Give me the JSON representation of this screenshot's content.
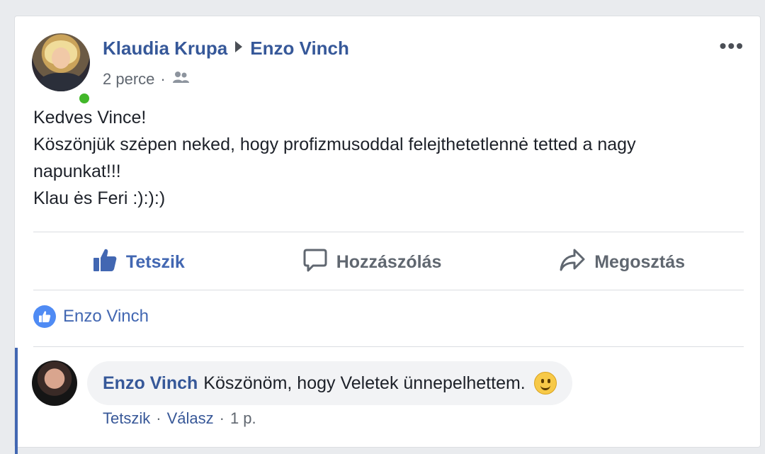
{
  "post": {
    "author": "Klaudia Krupa",
    "target": "Enzo Vinch",
    "time": "2 perce",
    "separator": "·",
    "more_label": "•••",
    "text_lines": [
      "Kedves Vince!",
      "Köszönjük szėpen neked, hogy profizmusoddal felejthetetlennė tetted a nagy",
      "napunkat!!!",
      "Klau ės Feri :):):)"
    ]
  },
  "actions": {
    "like": "Tetszik",
    "comment": "Hozzászólás",
    "share": "Megosztás"
  },
  "likes": {
    "names": "Enzo Vinch"
  },
  "comment": {
    "author": "Enzo Vinch",
    "text": "Köszönöm, hogy Veletek ünnepelhettem.",
    "like_link": "Tetszik",
    "reply_link": "Válasz",
    "time": "1 p.",
    "separator": "·"
  },
  "colors": {
    "link": "#365899",
    "like_blue": "#4267b2",
    "online": "#42b72a",
    "bubble_bg": "#f2f3f5"
  },
  "icons": {
    "audience": "friends-icon",
    "like": "thumbs-up-icon",
    "comment": "speech-bubble-icon",
    "share": "share-arrow-icon",
    "emoji": "smiley-emoji"
  }
}
